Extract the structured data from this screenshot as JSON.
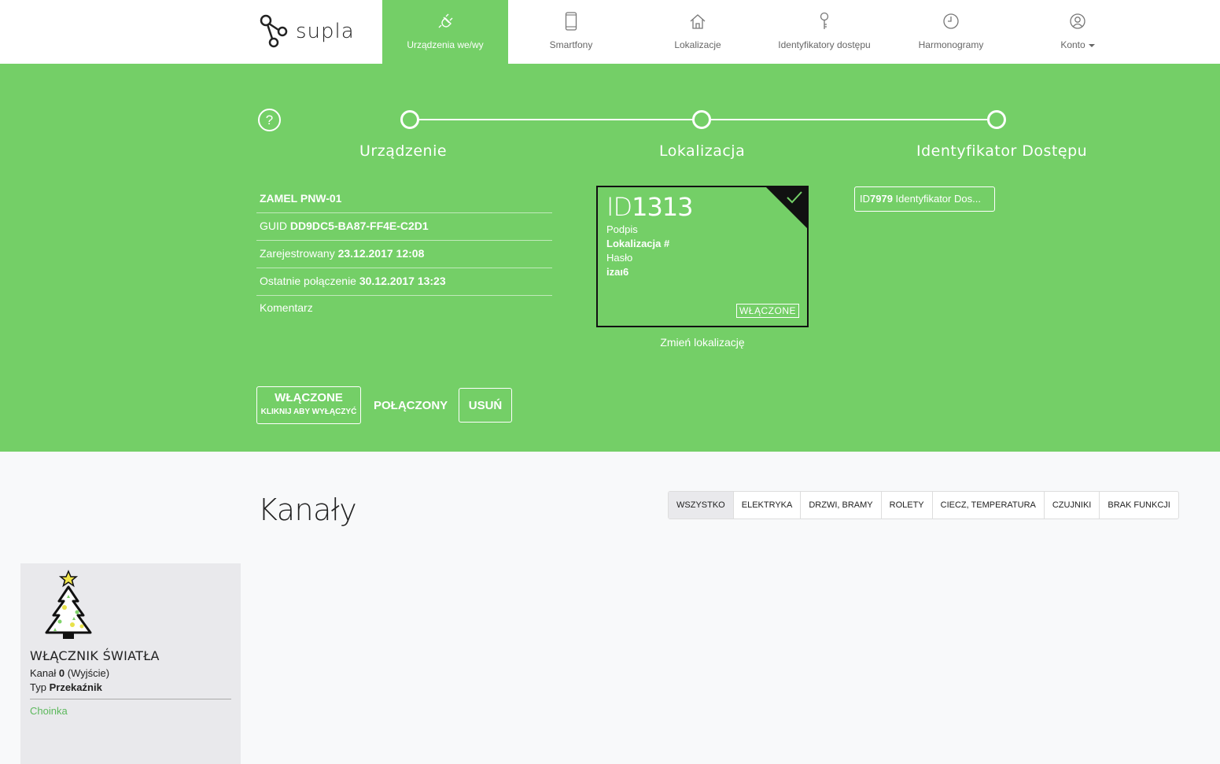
{
  "brand": {
    "name": "supla"
  },
  "nav": {
    "items": [
      {
        "label": "Urządzenia we/wy",
        "icon": "plug-icon",
        "active": true
      },
      {
        "label": "Smartfony",
        "icon": "smartphone-icon"
      },
      {
        "label": "Lokalizacje",
        "icon": "home-icon"
      },
      {
        "label": "Identyfikatory dostępu",
        "icon": "key-icon"
      },
      {
        "label": "Harmonogramy",
        "icon": "clock-icon"
      },
      {
        "label": "Konto",
        "icon": "user-icon",
        "dropdown": true
      }
    ]
  },
  "steps": {
    "help": "?",
    "labels": [
      "Urządzenie",
      "Lokalizacja",
      "Identyfikator Dostępu"
    ]
  },
  "device": {
    "name": "ZAMEL PNW-01",
    "guid_label": "GUID",
    "guid": "DD9DC5-BA87-FF4E-C2D1",
    "registered_label": "Zarejestrowany",
    "registered": "23.12.2017 12:08",
    "last_conn_label": "Ostatnie połączenie",
    "last_conn": "30.12.2017 13:23",
    "comment_label": "Komentarz"
  },
  "location": {
    "id_prefix": "ID",
    "id": "1313",
    "caption_label": "Podpis",
    "caption": "Lokalizacja #",
    "password_label": "Hasło",
    "password": "izaı6",
    "status": "WŁĄCZONE",
    "change_link": "Zmień lokalizację"
  },
  "access_id": {
    "prefix": "ID",
    "id": "7979",
    "label": "Identyfikator Dos..."
  },
  "actions": {
    "enabled_line1": "WŁĄCZONE",
    "enabled_line2": "KLIKNIJ ABY WYŁĄCZYĆ",
    "connection": "POŁĄCZONY",
    "delete": "USUŃ"
  },
  "channels": {
    "title": "Kanały",
    "filters": [
      "WSZYSTKO",
      "ELEKTRYKA",
      "DRZWI, BRAMY",
      "ROLETY",
      "CIECZ, TEMPERATURA",
      "CZUJNIKI",
      "BRAK FUNKCJI"
    ],
    "active_filter": "WSZYSTKO",
    "items": [
      {
        "icon": "christmas-tree-icon",
        "title": "WŁĄCZNIK ŚWIATŁA",
        "channel_label": "Kanał",
        "channel_no": "0",
        "channel_dir": "(Wyjście)",
        "type_label": "Typ",
        "type": "Przekaźnik",
        "caption": "Choinka"
      }
    ]
  },
  "colors": {
    "accent": "#74cf67",
    "accent_text": "#5cb85c",
    "card_bg": "#e9e9ec",
    "page_bg": "#f8f9fa"
  }
}
